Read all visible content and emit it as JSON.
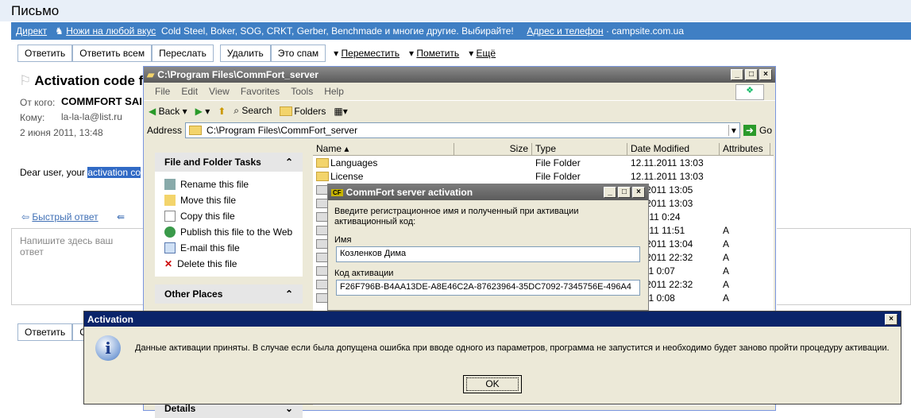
{
  "mail": {
    "header_title": "Письмо",
    "ad": {
      "direct": "Директ",
      "title": "Ножи на любой вкус",
      "text": "Cold Steel, Boker, SOG, CRKT, Gerber, Benchmade и многие другие. Выбирайте!",
      "address_link": "Адрес и телефон",
      "separator": "·",
      "domain": "campsite.com.ua"
    },
    "toolbar": {
      "reply": "Ответить",
      "reply_all": "Ответить всем",
      "forward": "Переслать",
      "delete": "Удалить",
      "spam": "Это спам",
      "move": "Переместить",
      "mark": "Пометить",
      "more": "Ещё"
    },
    "subject": "Activation code fo",
    "from_label": "От кого:",
    "from_value": "COMMFORT SAI",
    "to_label": "Кому:",
    "to_value": "la-la-la@list.ru",
    "date": "2 июня 2011, 13:48",
    "body_prefix": "Dear user, your ",
    "body_highlight": "activation co",
    "quick_reply": "Быстрый ответ",
    "reply_placeholder": "Напишите здесь ваш ответ",
    "bottom_reply": "Ответить",
    "bottom_other": "О"
  },
  "explorer": {
    "title": "C:\\Program Files\\CommFort_server",
    "menu": [
      "File",
      "Edit",
      "View",
      "Favorites",
      "Tools",
      "Help"
    ],
    "toolbar": {
      "back": "Back",
      "search": "Search",
      "folders": "Folders"
    },
    "address_label": "Address",
    "address_value": "C:\\Program Files\\CommFort_server",
    "go": "Go",
    "tasks_title": "File and Folder Tasks",
    "tasks": [
      "Rename this file",
      "Move this file",
      "Copy this file",
      "Publish this file to the Web",
      "E-mail this file",
      "Delete this file"
    ],
    "other_places": "Other Places",
    "details": "Details",
    "columns": {
      "name": "Name",
      "size": "Size",
      "type": "Type",
      "date": "Date Modified",
      "attr": "Attributes"
    },
    "files": [
      {
        "name": "Languages",
        "type": "File Folder",
        "date": "12.11.2011 13:03",
        "attr": ""
      },
      {
        "name": "License",
        "type": "File Folder",
        "date": "12.11.2011 13:03",
        "attr": ""
      },
      {
        "name": "",
        "type": "",
        "date": ".11.2011 13:05",
        "attr": ""
      },
      {
        "name": "",
        "type": "",
        "date": ".11.2011 13:03",
        "attr": ""
      },
      {
        "name": "",
        "type": "",
        "date": "9.2011 0:24",
        "attr": ""
      },
      {
        "name": "",
        "type": "",
        "date": "5.2011 11:51",
        "attr": "A"
      },
      {
        "name": "",
        "type": "",
        "date": ".11.2011 13:04",
        "attr": "A"
      },
      {
        "name": "",
        "type": "",
        "date": ".11.2011 22:32",
        "attr": "A"
      },
      {
        "name": "",
        "type": "",
        "date": ".2011 0:07",
        "attr": "A"
      },
      {
        "name": "",
        "type": "",
        "date": ".11.2011 22:32",
        "attr": "A"
      },
      {
        "name": "",
        "type": "",
        "date": ".2011 0:08",
        "attr": "A"
      }
    ]
  },
  "activation_window": {
    "title": "CommFort server activation",
    "prompt": "Введите регистрационное имя и полученный при активации активационный код:",
    "name_label": "Имя",
    "name_value": "Козленков Дима",
    "code_label": "Код активации",
    "code_value": "F26F796B-B4AA13DE-A8E46C2A-87623964-35DC7092-7345756E-496A4"
  },
  "message_box": {
    "title": "Activation",
    "text": "Данные активации приняты. В случае если была допущена ошибка при вводе одного из параметров, программа не запустится и необходимо будет заново пройти процедуру активации.",
    "ok": "OK"
  }
}
